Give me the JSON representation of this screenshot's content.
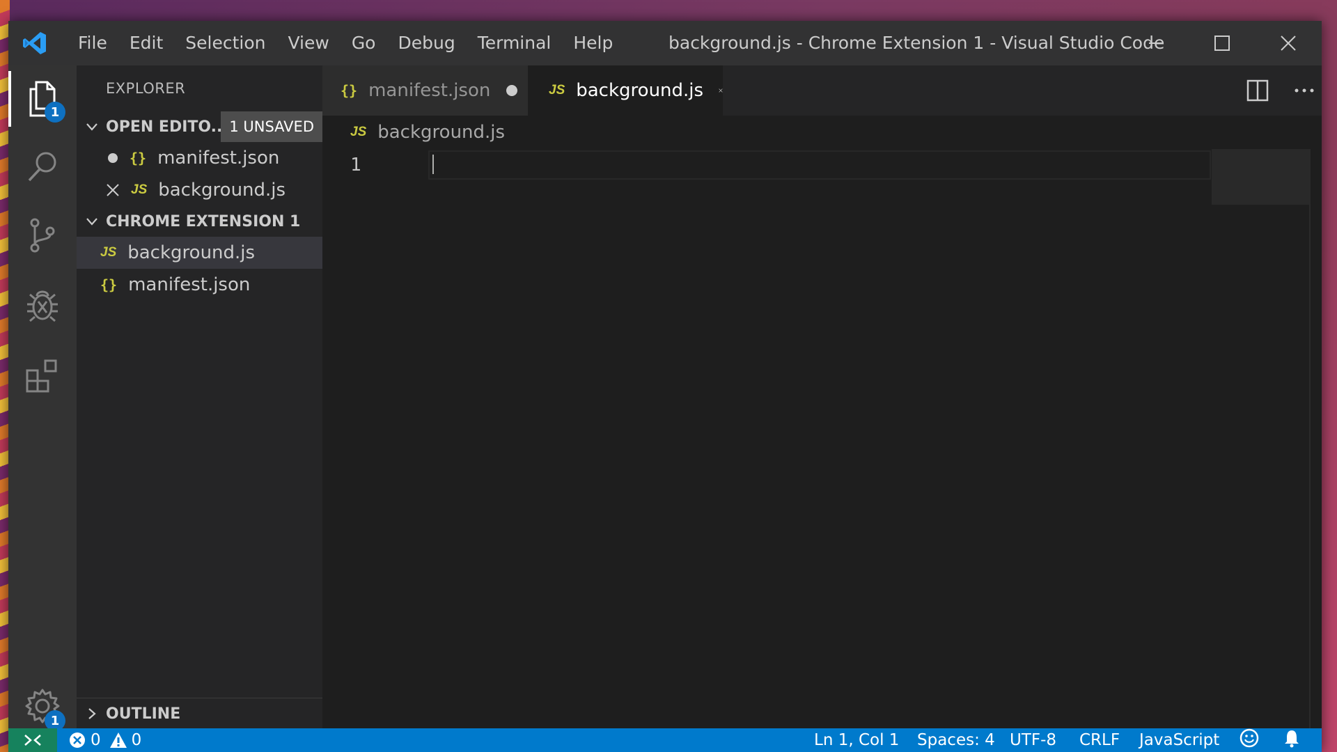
{
  "titlebar": {
    "menu": [
      "File",
      "Edit",
      "Selection",
      "View",
      "Go",
      "Debug",
      "Terminal",
      "Help"
    ],
    "title": "background.js - Chrome Extension 1 - Visual Studio Code",
    "icons": [
      "vscode-logo-icon",
      "minimize-icon",
      "maximize-icon",
      "close-icon"
    ]
  },
  "activitybar": {
    "items": [
      {
        "name": "explorer",
        "icon": "files-icon",
        "badge": "1"
      },
      {
        "name": "search",
        "icon": "search-icon"
      },
      {
        "name": "source-control",
        "icon": "source-control-icon"
      },
      {
        "name": "debug",
        "icon": "debug-icon"
      },
      {
        "name": "extensions",
        "icon": "extensions-icon"
      }
    ],
    "manage": {
      "icon": "gear-icon",
      "badge": "1"
    }
  },
  "sidebar": {
    "title": "EXPLORER",
    "open_editors": {
      "header": "OPEN EDITO...",
      "badge": "1 UNSAVED",
      "items": [
        {
          "label": "manifest.json",
          "type": "{}",
          "state": "unsaved-dot"
        },
        {
          "label": "background.js",
          "type": "JS",
          "state": "close"
        }
      ]
    },
    "folder": {
      "header": "CHROME EXTENSION 1",
      "items": [
        {
          "label": "background.js",
          "type": "JS"
        },
        {
          "label": "manifest.json",
          "type": "{}"
        }
      ]
    },
    "outline": {
      "header": "OUTLINE"
    }
  },
  "tabs": [
    {
      "label": "manifest.json",
      "type": "{}",
      "dirty": true
    },
    {
      "label": "background.js",
      "type": "JS",
      "active": true
    }
  ],
  "editor": {
    "breadcrumb": "background.js",
    "breadcrumb_type": "JS",
    "line_numbers": [
      "1"
    ]
  },
  "statusbar": {
    "errors": "0",
    "warnings": "0",
    "position": "Ln 1, Col 1",
    "spaces": "Spaces: 4",
    "encoding": "UTF-8",
    "eol": "CRLF",
    "language": "JavaScript"
  },
  "colors": {
    "accent": "#007acc",
    "badge": "#0e70c0",
    "remote": "#16825d",
    "file_glyph": "#cbcb41"
  }
}
